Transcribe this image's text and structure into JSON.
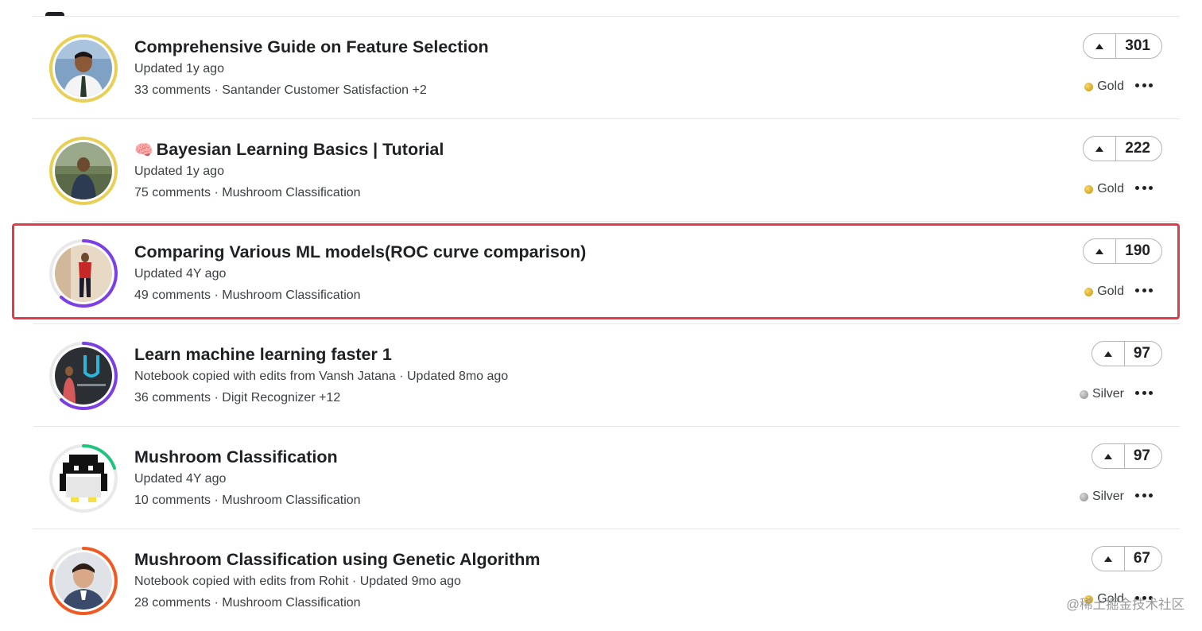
{
  "notebooks": [
    {
      "title": "Comprehensive Guide on Feature Selection",
      "emoji": "",
      "updated": "Updated 1y ago",
      "details": "33 comments · Santander Customer Satisfaction +2",
      "votes": "301",
      "medal": "Gold",
      "medal_color": "#d4a017",
      "ring_color": "#e8cf55",
      "ring_type": "full"
    },
    {
      "title": "Bayesian Learning Basics | Tutorial",
      "emoji": "🧠",
      "updated": "Updated 1y ago",
      "details": "75 comments · Mushroom Classification",
      "votes": "222",
      "medal": "Gold",
      "medal_color": "#d4a017",
      "ring_color": "#e8cf55",
      "ring_type": "full"
    },
    {
      "title": "Comparing Various ML models(ROC curve comparison)",
      "emoji": "",
      "updated": "Updated 4Y ago",
      "details": "49 comments · Mushroom Classification",
      "votes": "190",
      "medal": "Gold",
      "medal_color": "#d4a017",
      "ring_color": "#7b3fe4",
      "ring_type": "partial"
    },
    {
      "title": "Learn machine learning faster 1",
      "emoji": "",
      "updated": "Notebook copied with edits from Vansh Jatana · Updated 8mo ago",
      "details": "36 comments · Digit Recognizer +12",
      "votes": "97",
      "medal": "Silver",
      "medal_color": "#9e9e9e",
      "ring_color": "#7b3fe4",
      "ring_type": "partial"
    },
    {
      "title": "Mushroom Classification",
      "emoji": "",
      "updated": "Updated 4Y ago",
      "details": "10 comments · Mushroom Classification",
      "votes": "97",
      "medal": "Silver",
      "medal_color": "#9e9e9e",
      "ring_color": "#20c57d",
      "ring_type": "small"
    },
    {
      "title": "Mushroom Classification using Genetic Algorithm",
      "emoji": "",
      "updated": "Notebook copied with edits from Rohit · Updated 9mo ago",
      "details": "28 comments · Mushroom Classification",
      "votes": "67",
      "medal": "Gold",
      "medal_color": "#d4a017",
      "ring_color": "#f05a22",
      "ring_type": "partial"
    }
  ],
  "watermark": "@稀土掘金技术社区",
  "highlight_color": "#e13b4a"
}
